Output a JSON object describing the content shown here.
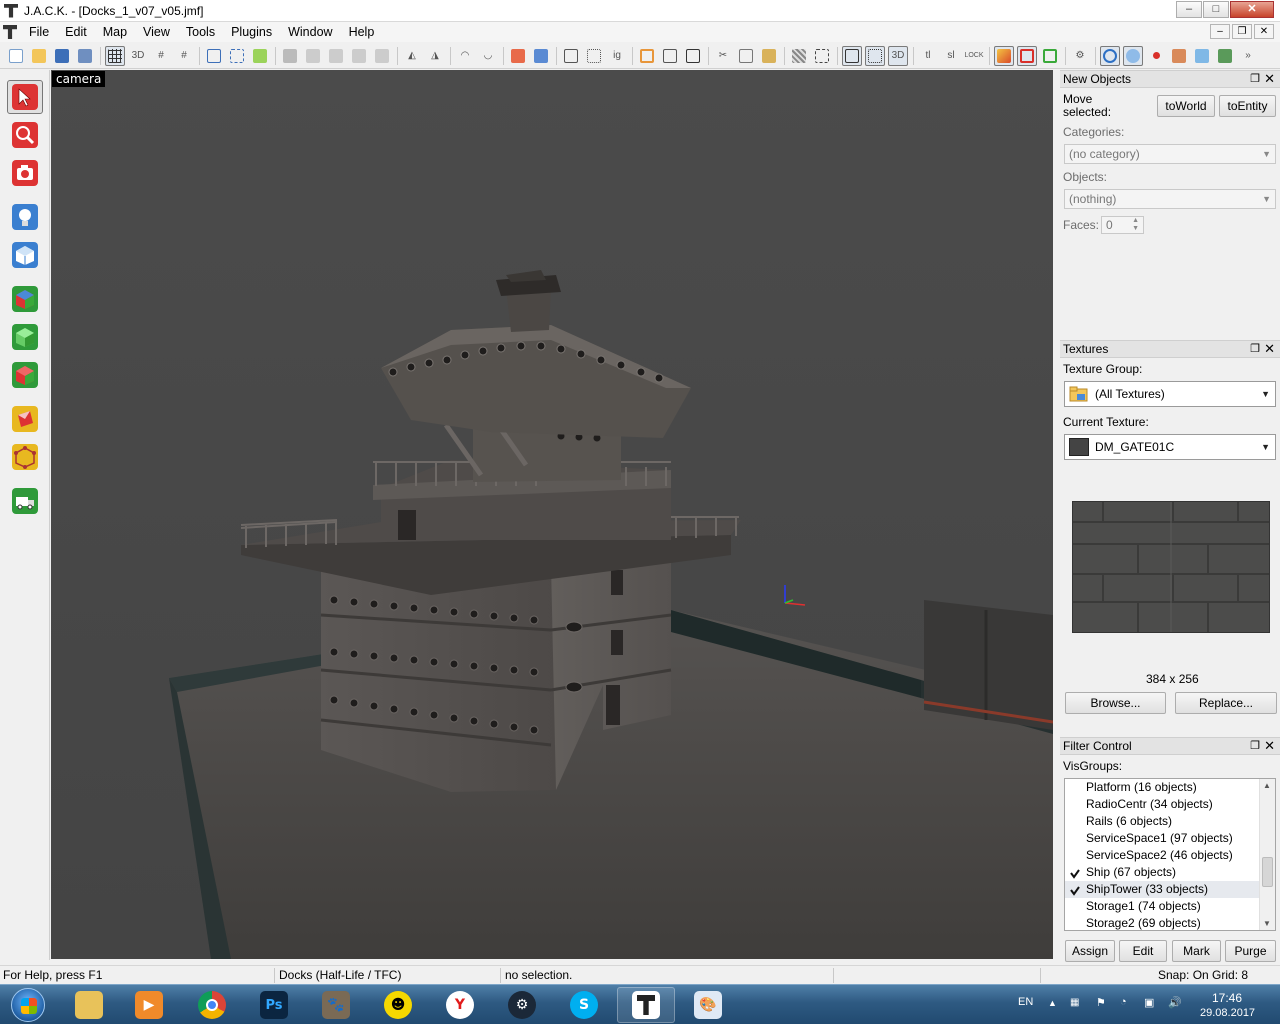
{
  "window": {
    "title": "J.A.C.K. - [Docks_1_v07_v05.jmf]",
    "controls": {
      "minimize": "–",
      "maximize": "□",
      "close": "✕"
    }
  },
  "menu": [
    "File",
    "Edit",
    "Map",
    "View",
    "Tools",
    "Plugins",
    "Window",
    "Help"
  ],
  "viewport": {
    "label": "camera"
  },
  "new_objects": {
    "title": "New Objects",
    "move_selected_label": "Move selected:",
    "to_world": "toWorld",
    "to_entity": "toEntity",
    "categories_label": "Categories:",
    "categories_value": "(no category)",
    "objects_label": "Objects:",
    "objects_value": "(nothing)",
    "faces_label": "Faces:",
    "faces_value": "0"
  },
  "textures": {
    "title": "Textures",
    "group_label": "Texture Group:",
    "group_value": "(All Textures)",
    "current_label": "Current Texture:",
    "current_value": "DM_GATE01C",
    "size": "384 x 256",
    "browse": "Browse...",
    "replace": "Replace..."
  },
  "filter": {
    "title": "Filter Control",
    "visgroups_label": "VisGroups:",
    "items": [
      {
        "label": "Platform (16 objects)",
        "checked": false,
        "selected": false
      },
      {
        "label": "RadioCentr (34 objects)",
        "checked": false,
        "selected": false
      },
      {
        "label": "Rails (6 objects)",
        "checked": false,
        "selected": false
      },
      {
        "label": "ServiceSpace1 (97 objects)",
        "checked": false,
        "selected": false
      },
      {
        "label": "ServiceSpace2 (46 objects)",
        "checked": false,
        "selected": false
      },
      {
        "label": "Ship (67 objects)",
        "checked": true,
        "selected": false
      },
      {
        "label": "ShipTower (33 objects)",
        "checked": true,
        "selected": true
      },
      {
        "label": "Storage1 (74 objects)",
        "checked": false,
        "selected": false
      },
      {
        "label": "Storage2 (69 objects)",
        "checked": false,
        "selected": false
      }
    ],
    "assign": "Assign",
    "edit": "Edit",
    "mark": "Mark",
    "purge": "Purge"
  },
  "status": {
    "help": "For Help, press F1",
    "game": "Docks (Half-Life / TFC)",
    "selection": "no selection.",
    "snap": "Snap: On Grid: 8"
  },
  "taskbar": {
    "language": "EN",
    "time": "17:46",
    "date": "29.08.2017",
    "apps": [
      "explorer",
      "media-player",
      "chrome",
      "photoshop",
      "gimp",
      "yellow-app",
      "yandex",
      "steam",
      "skype",
      "jack",
      "paint"
    ]
  },
  "colors": {
    "viewport_bg": "#4a4a4a",
    "selection_highlight": "#e6e9ee",
    "taskbar": "#2e5a82"
  }
}
